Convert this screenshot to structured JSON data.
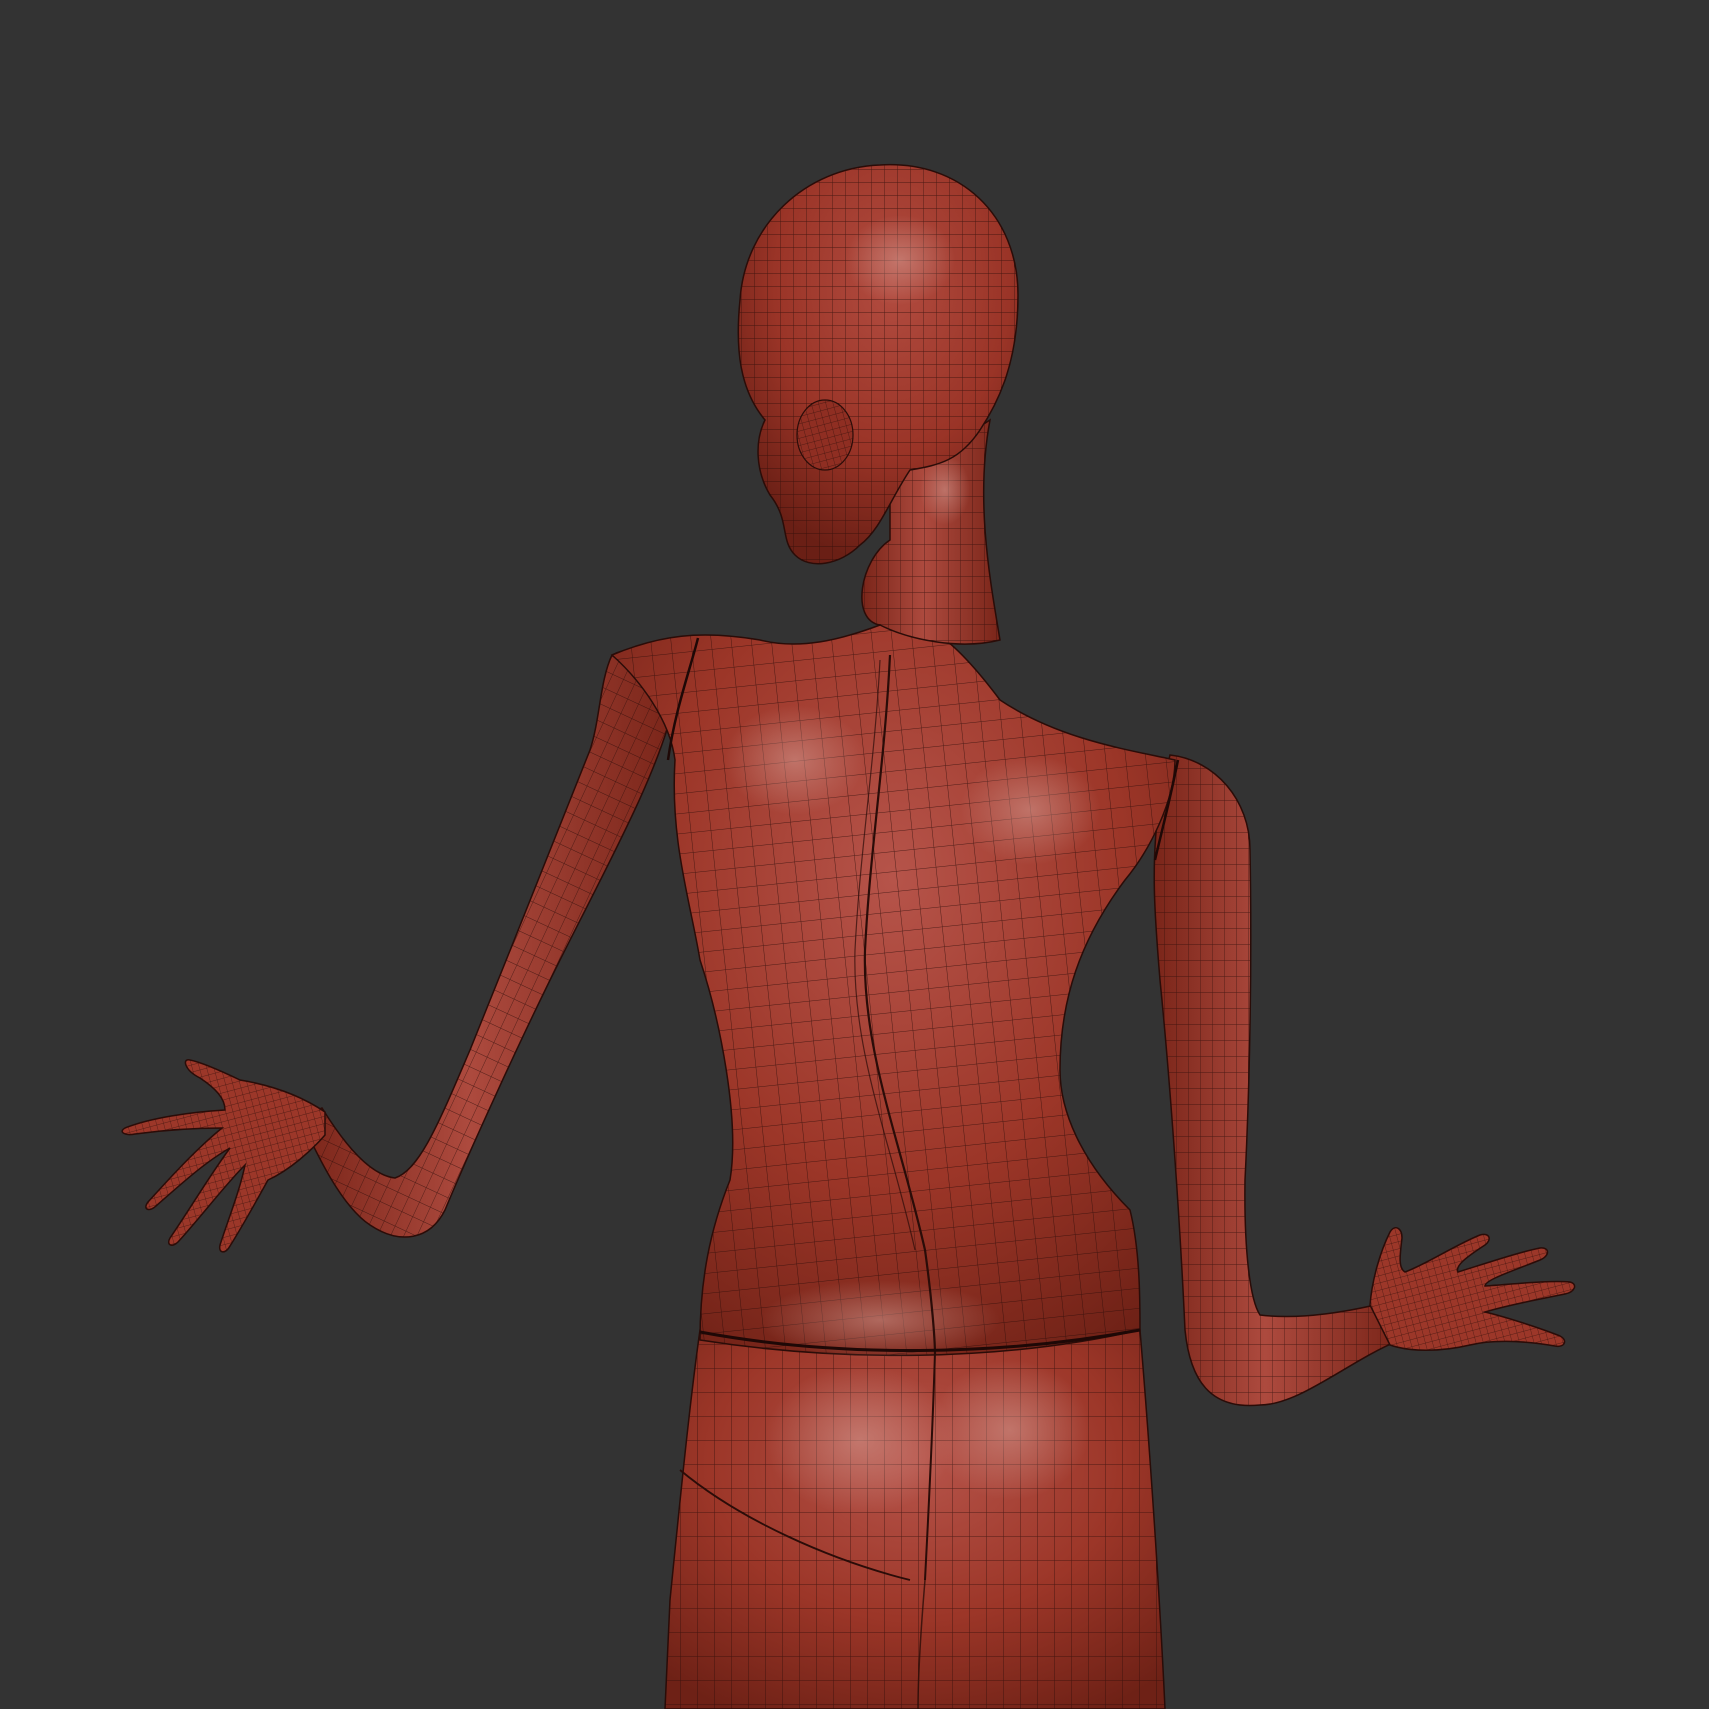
{
  "scene": {
    "background_color": "#333333",
    "subject": "wireframe-mesh-figure",
    "view": "back",
    "material": {
      "base_color": "#a8382b",
      "shadow_color": "#6b1e14",
      "highlight_color": "#c98a80",
      "wire_color": "#2a0c08"
    }
  }
}
